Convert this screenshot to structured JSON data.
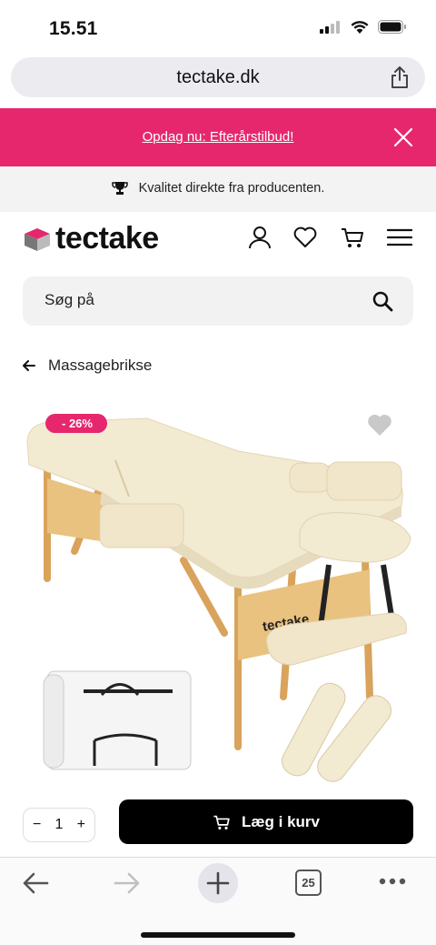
{
  "status_bar": {
    "time": "15.51",
    "icons": [
      "cellular-icon",
      "wifi-icon",
      "battery-icon"
    ]
  },
  "browser": {
    "url": "tectake.dk",
    "tab_count": "25"
  },
  "promo": {
    "text": "Opdag nu: Efterårstilbud!",
    "color": "#e6276e"
  },
  "quality": {
    "text": "Kvalitet direkte fra producenten."
  },
  "header": {
    "logo_text": "tectake",
    "icons": [
      "user-icon",
      "heart-icon",
      "cart-icon",
      "menu-icon"
    ]
  },
  "search": {
    "placeholder": "Søg på"
  },
  "breadcrumb": {
    "label": "Massagebrikse"
  },
  "product": {
    "discount_badge": "- 26%",
    "bag_logo": "tectake"
  },
  "purchase": {
    "quantity": "1",
    "minus": "−",
    "plus": "+",
    "cart_label": "Læg i kurv"
  }
}
